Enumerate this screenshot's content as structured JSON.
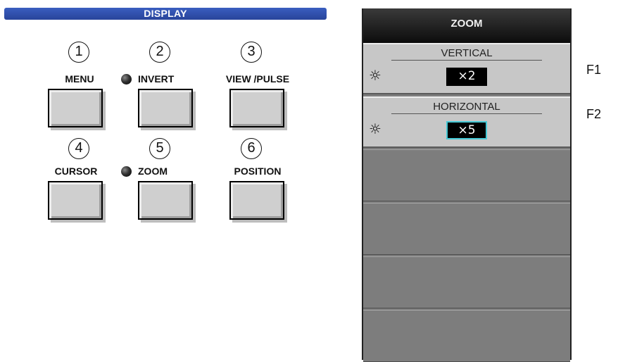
{
  "panel": {
    "title": "DISPLAY",
    "buttons": [
      {
        "number": "1",
        "label": "MENU",
        "led": false
      },
      {
        "number": "2",
        "label": "INVERT",
        "led": true
      },
      {
        "number": "3",
        "label": "VIEW /PULSE",
        "led": false
      },
      {
        "number": "4",
        "label": "CURSOR",
        "led": false
      },
      {
        "number": "5",
        "label": "ZOOM",
        "led": true
      },
      {
        "number": "6",
        "label": "POSITION",
        "led": false
      }
    ]
  },
  "screen": {
    "title": "ZOOM",
    "softkeys": [
      {
        "title": "VERTICAL",
        "icon": "knob-icon",
        "value": "×2",
        "selected": false
      },
      {
        "title": "HORIZONTAL",
        "icon": "knob-icon",
        "value": "×5",
        "selected": true
      }
    ],
    "empty_keys": 4
  },
  "function_keys": [
    "F1",
    "F2"
  ],
  "colors": {
    "header_blue": "#3253b0",
    "selection_cyan": "#46c9d6",
    "softkey_grey": "#c7c7c7",
    "screen_grey": "#7d7d7d"
  }
}
